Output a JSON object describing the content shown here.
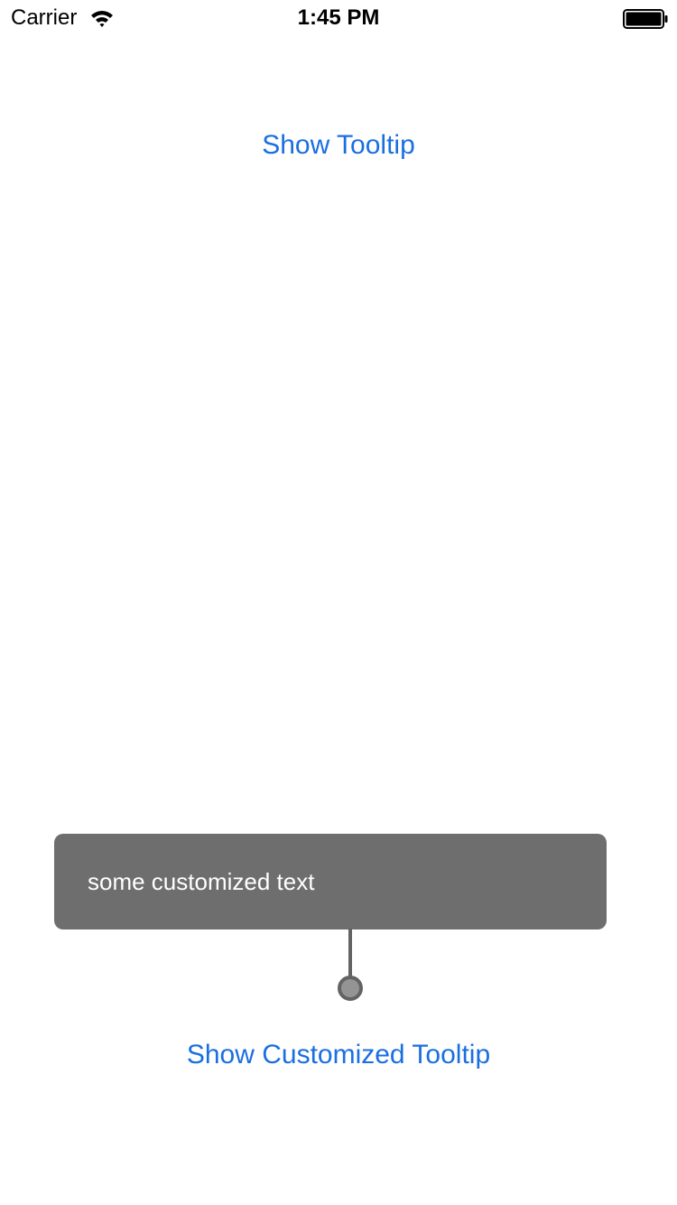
{
  "status_bar": {
    "carrier": "Carrier",
    "time": "1:45 PM",
    "wifi_icon": "wifi-icon",
    "battery_icon": "battery-icon"
  },
  "main": {
    "show_tooltip_label": "Show Tooltip",
    "show_customized_tooltip_label": "Show Customized Tooltip"
  },
  "tooltip": {
    "text": "some customized text",
    "pointer_icon": "tooltip-pointer-icon"
  },
  "colors": {
    "accent": "#1a6fe0",
    "tooltip_background": "#6e6e6e",
    "tooltip_text": "#ffffff",
    "pointer_stroke": "#636363",
    "pointer_fill": "#949494"
  }
}
